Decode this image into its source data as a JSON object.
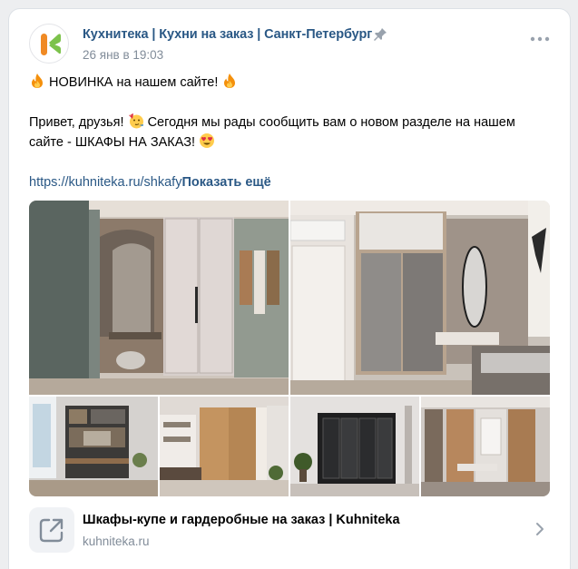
{
  "post": {
    "author": "Кухнитека | Кухни на заказ | Санкт-Петербург",
    "time": "26 янв в 19:03",
    "headline": "НОВИНКА на нашем сайте!",
    "body_line1": "Привет, друзья!",
    "body_line1_cont": "Сегодня мы рады сообщить вам о новом разделе на нашем",
    "body_line2": "сайте - ШКАФЫ НА ЗАКАЗ!",
    "link_url": "https://kuhniteka.ru/shkafy",
    "show_more": "Показать ещё"
  },
  "attachment": {
    "title": "Шкафы-купе и гардеробные на заказ | Kuhniteka",
    "domain": "kuhniteka.ru"
  },
  "icons": {
    "pin": "pin-icon",
    "more": "more-dots-icon",
    "fire": "fire-emoji",
    "party": "partying-face-emoji",
    "heart_eyes": "heart-eyes-emoji",
    "external_link": "external-link-icon",
    "chevron": "chevron-right-icon"
  },
  "colors": {
    "link": "#2a5885",
    "secondary": "#818c99",
    "logo_green": "#7cc24b",
    "logo_orange": "#f08a24"
  },
  "gallery": {
    "photos": [
      "wardrobe-with-round-mirror",
      "bedroom-sliding-wardrobe",
      "office-shelving",
      "wood-sliding-wardrobe",
      "black-wardrobe",
      "hallway-wardrobe"
    ]
  }
}
